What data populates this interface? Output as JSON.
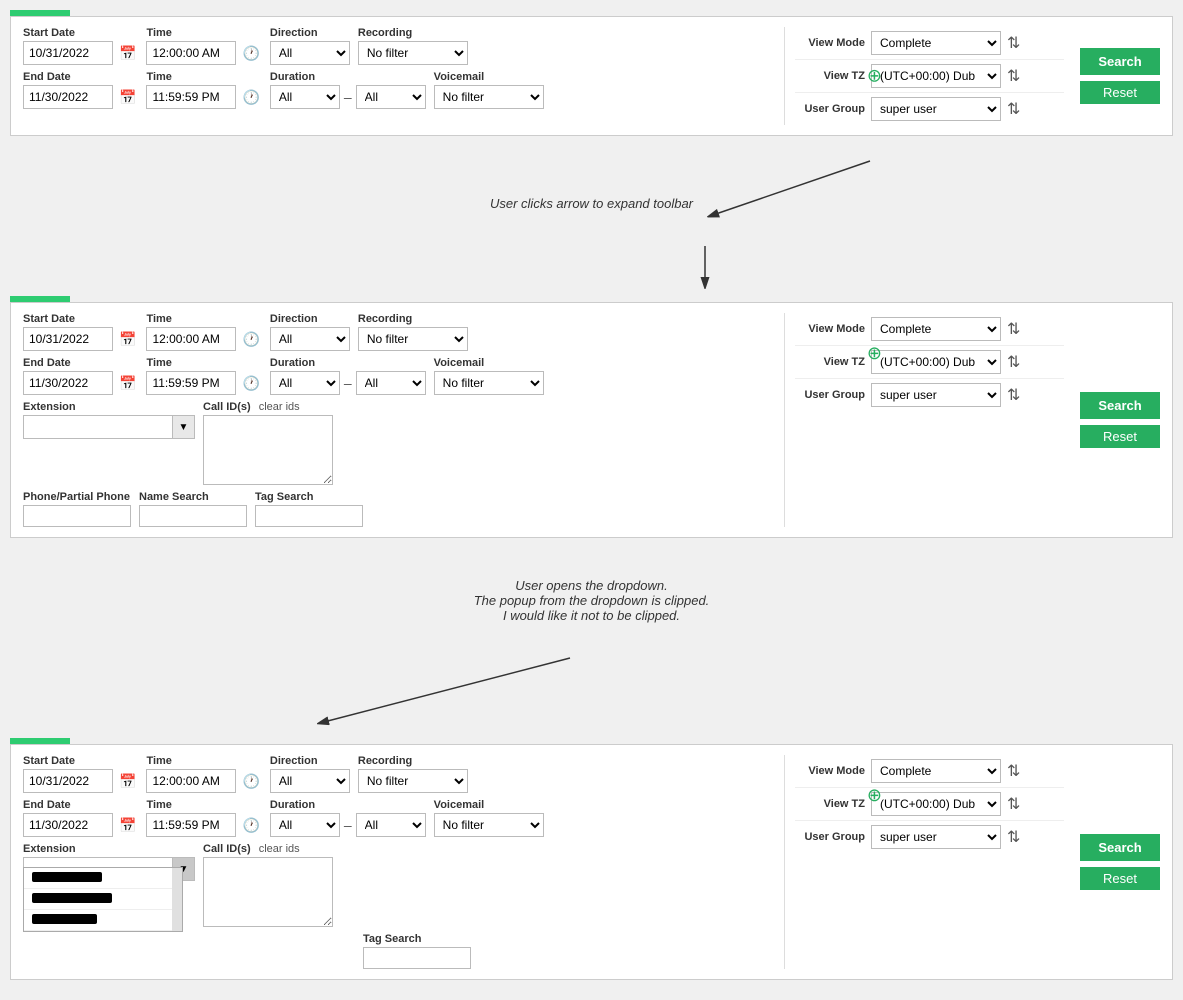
{
  "colors": {
    "green": "#27ae60",
    "border": "#ccc",
    "bg": "#fff"
  },
  "toolbar1": {
    "startDate": {
      "label": "Start Date",
      "value": "10/31/2022"
    },
    "startTime": {
      "label": "Time",
      "value": "12:00:00 AM"
    },
    "endDate": {
      "label": "End Date",
      "value": "11/30/2022"
    },
    "endTime": {
      "label": "Time",
      "value": "11:59:59 PM"
    },
    "direction": {
      "label": "Direction",
      "value": "All"
    },
    "duration_label": "Duration",
    "duration_from": "All",
    "duration_to": "All",
    "recording": {
      "label": "Recording",
      "value": "No filter"
    },
    "voicemail": {
      "label": "Voicemail",
      "value": "No filter"
    },
    "viewMode": {
      "label": "View Mode",
      "value": "Complete"
    },
    "viewTZ": {
      "label": "View TZ",
      "value": "(UTC+00:00) Dub"
    },
    "userGroup": {
      "label": "User Group",
      "value": "super user"
    },
    "searchBtn": "Search",
    "resetBtn": "Reset",
    "expandIcon": "⊕"
  },
  "annotation1": {
    "text": "User clicks arrow to expand toolbar"
  },
  "toolbar2": {
    "startDate": {
      "label": "Start Date",
      "value": "10/31/2022"
    },
    "startTime": {
      "label": "Time",
      "value": "12:00:00 AM"
    },
    "endDate": {
      "label": "End Date",
      "value": "11/30/2022"
    },
    "endTime": {
      "label": "Time",
      "value": "11:59:59 PM"
    },
    "direction": {
      "label": "Direction",
      "value": "All"
    },
    "duration_label": "Duration",
    "duration_from": "All",
    "duration_to": "All",
    "recording": {
      "label": "Recording",
      "value": "No filter"
    },
    "voicemail": {
      "label": "Voicemail",
      "value": "No filter"
    },
    "extension": {
      "label": "Extension"
    },
    "callIds": {
      "label": "Call ID(s)",
      "clearLabel": "clear ids"
    },
    "phonePP": {
      "label": "Phone/Partial Phone"
    },
    "nameSearch": {
      "label": "Name Search"
    },
    "tagSearch": {
      "label": "Tag Search"
    },
    "viewMode": {
      "label": "View Mode",
      "value": "Complete"
    },
    "viewTZ": {
      "label": "View TZ",
      "value": "(UTC+00:00) Dub"
    },
    "userGroup": {
      "label": "User Group",
      "value": "super user"
    },
    "searchBtn": "Search",
    "resetBtn": "Reset",
    "expandIcon": "⊕"
  },
  "annotation2": {
    "line1": "User opens the dropdown.",
    "line2": "The popup from the dropdown is clipped.",
    "line3": "I would like it not to be clipped."
  },
  "toolbar3": {
    "startDate": {
      "label": "Start Date",
      "value": "10/31/2022"
    },
    "startTime": {
      "label": "Time",
      "value": "12:00:00 AM"
    },
    "endDate": {
      "label": "End Date",
      "value": "11/30/2022"
    },
    "endTime": {
      "label": "Time",
      "value": "11:59:59 PM"
    },
    "direction": {
      "label": "Direction",
      "value": "All"
    },
    "duration_label": "Duration",
    "duration_from": "All",
    "duration_to": "All",
    "recording": {
      "label": "Recording",
      "value": "No filter"
    },
    "voicemail": {
      "label": "Voicemail",
      "value": "No filter"
    },
    "extension": {
      "label": "Extension"
    },
    "callIds": {
      "label": "Call ID(s)",
      "clearLabel": "clear ids"
    },
    "tagSearch": {
      "label": "Tag Search"
    },
    "viewMode": {
      "label": "View Mode",
      "value": "Complete"
    },
    "viewTZ": {
      "label": "View TZ",
      "value": "(UTC+00:00) Dub"
    },
    "userGroup": {
      "label": "User Group",
      "value": "super user"
    },
    "searchBtn": "Search",
    "resetBtn": "Reset",
    "expandIcon": "⊕",
    "dropdown": {
      "items": [
        "██████████",
        "████████████",
        "██████████"
      ]
    }
  }
}
